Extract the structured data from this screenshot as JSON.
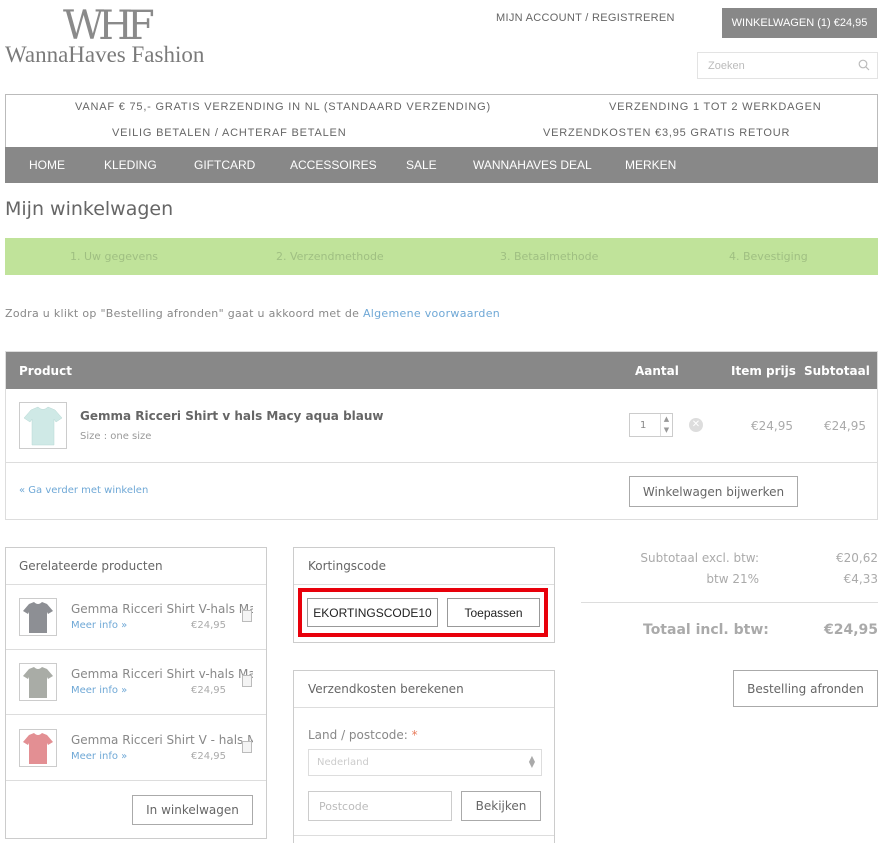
{
  "header": {
    "logo_mark": "WHF",
    "logo_text": "WannaHaves Fashion",
    "account_link": "MIJN ACCOUNT / REGISTREREN",
    "cart_button": "WINKELWAGEN (1) €24,95",
    "search_placeholder": "Zoeken"
  },
  "info_banner": {
    "line1_left": "VANAF € 75,- GRATIS VERZENDING IN NL (STANDAARD VERZENDING)",
    "line1_right": "VERZENDING 1 TOT 2 WERKDAGEN",
    "line2_left": "VEILIG BETALEN / ACHTERAF BETALEN",
    "line2_right": "VERZENDKOSTEN €3,95 GRATIS RETOUR"
  },
  "nav": {
    "items": [
      "HOME",
      "KLEDING",
      "GIFTCARD",
      "ACCESSOIRES",
      "SALE",
      "WANNAHAVES DEAL",
      "MERKEN"
    ]
  },
  "page_title": "Mijn winkelwagen",
  "steps": [
    "1.  Uw gegevens",
    "2.  Verzendmethode",
    "3.  Betaalmethode",
    "4.  Bevestiging"
  ],
  "terms": {
    "text": "Zodra u klikt op \"Bestelling afronden\" gaat u akkoord met de ",
    "link": "Algemene voorwaarden"
  },
  "cart_table": {
    "headers": [
      "Product",
      "Aantal",
      "Item prijs",
      "Subtotaal"
    ],
    "item": {
      "name": "Gemma Ricceri Shirt v hals Macy aqua blauw",
      "size": "Size : one size",
      "quantity": "1",
      "item_price": "€24,95",
      "subtotal": "€24,95"
    },
    "continue_link": "« Ga verder met winkelen",
    "update_button": "Winkelwagen bijwerken"
  },
  "related": {
    "title": "Gerelateerde producten",
    "items": [
      {
        "name": "Gemma Ricceri Shirt V-hals Ma",
        "link": "Meer info »",
        "price": "€24,95",
        "color": "#8d8f94"
      },
      {
        "name": "Gemma Ricceri Shirt v-hals Ma",
        "link": "Meer info »",
        "price": "€24,95",
        "color": "#a9aca6"
      },
      {
        "name": "Gemma Ricceri Shirt V - hals M",
        "link": "Meer info »",
        "price": "€24,95",
        "color": "#e38f93"
      }
    ],
    "add_button": "In winkelwagen"
  },
  "coupon": {
    "title": "Kortingscode",
    "code": "EKORTINGSCODE10",
    "apply_button": "Toepassen",
    "highlight_color": "#e8000b"
  },
  "shipping": {
    "title": "Verzendkosten berekenen",
    "country_label": "Land / postcode:",
    "required_mark": "*",
    "country_value": "Nederland",
    "postcode_placeholder": "Postcode",
    "view_button": "Bekijken"
  },
  "totals": {
    "subtotal_label": "Subtotaal excl. btw:",
    "subtotal_value": "€20,62",
    "vat_label": "btw 21%",
    "vat_value": "€4,33",
    "total_label": "Totaal incl. btw:",
    "total_value": "€24,95",
    "checkout_button": "Bestelling afronden"
  },
  "colors": {
    "nav_bg": "#888888",
    "steps_bg": "#c0e39a",
    "link": "#6fa8d6",
    "product_thumb": "#cfe9e6"
  }
}
